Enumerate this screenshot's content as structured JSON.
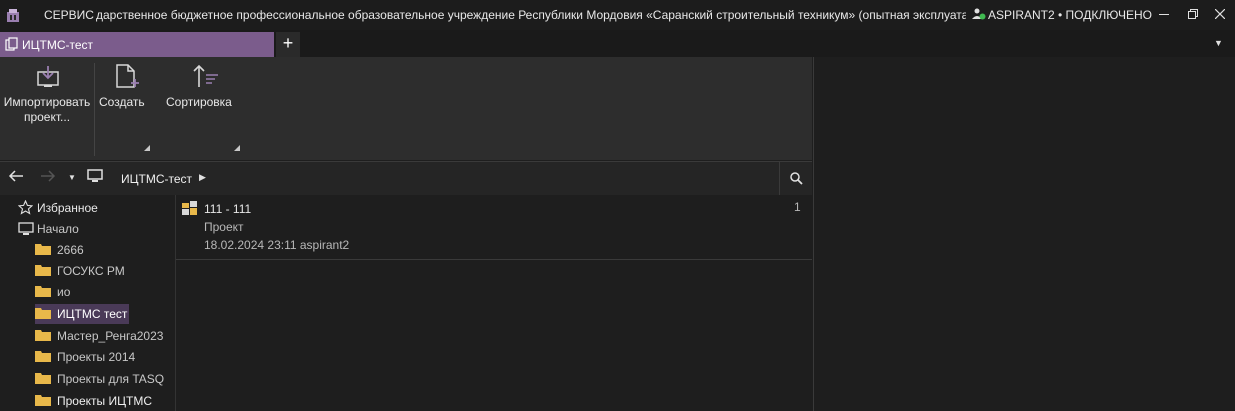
{
  "titlebar": {
    "service": "СЕРВИС",
    "org": "дарственное бюджетное профессиональное образовательное учреждение Республики Мордовия «Саранский строительный техникум» (опытная эксплуатаци",
    "connection": "ASPIRANT2 • ПОДКЛЮЧЕНО"
  },
  "tabs": {
    "active_label": "ИЦТМС-тест",
    "add_label": "+"
  },
  "ribbon": {
    "import_label": "Импортировать проект...",
    "create_label": "Создать",
    "sort_label": "Сортировка"
  },
  "nav": {
    "breadcrumb": "ИЦТМС-тест"
  },
  "tree": {
    "favorites": "Избранное",
    "home": "Начало",
    "folders": [
      "2666",
      "ГОСУКС РМ",
      "ио",
      "ИЦТМС тест",
      "Мастер_Ренга2023",
      "Проекты 2014",
      "Проекты для TASQ",
      "Проекты ИЦТМС"
    ],
    "selected": "ИЦТМС тест"
  },
  "items": [
    {
      "title": "111 - 111",
      "type": "Проект",
      "meta": "18.02.2024 23:11 aspirant2",
      "count": "1"
    }
  ],
  "colors": {
    "accent": "#7b5c8c",
    "selection": "#4a3a58",
    "folder": "#e8b84a",
    "online": "#3fb950"
  }
}
